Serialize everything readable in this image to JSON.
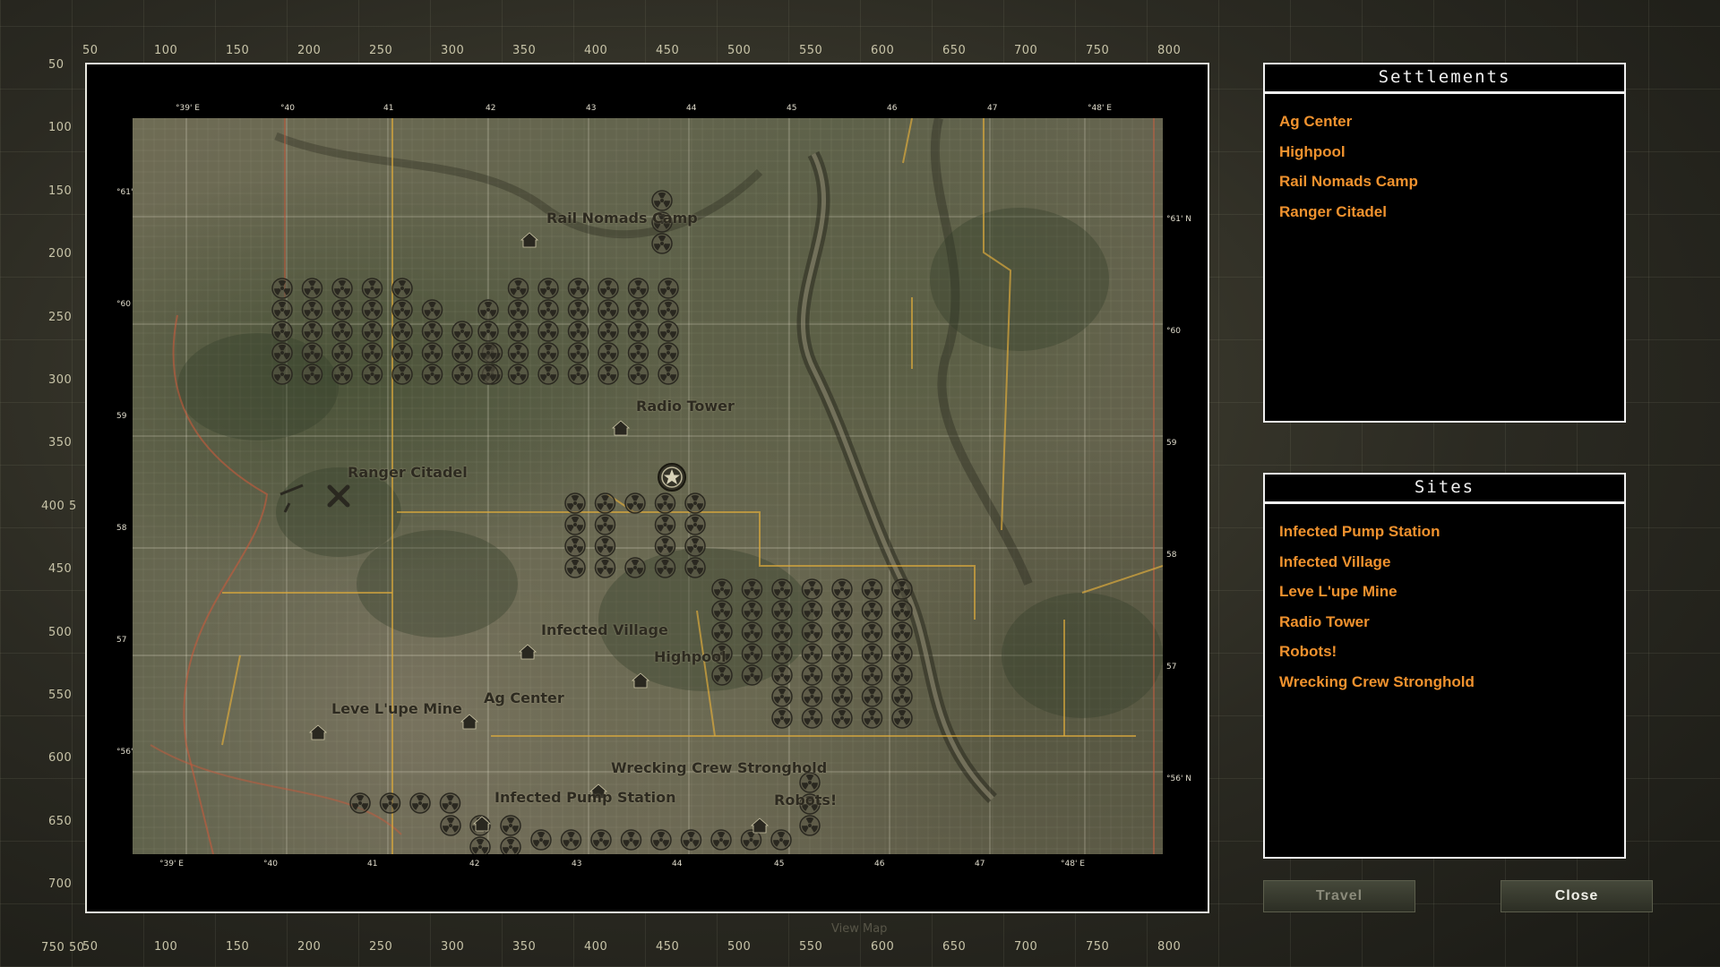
{
  "ruler": {
    "top": [
      "50",
      "100",
      "150",
      "200",
      "250",
      "300",
      "350",
      "400",
      "450",
      "500",
      "550",
      "600",
      "650",
      "700",
      "750",
      "800"
    ],
    "left": [
      "50",
      "100",
      "150",
      "200",
      "250",
      "300",
      "350",
      "400 5",
      "450",
      "500",
      "550",
      "600",
      "650",
      "700",
      "750 50"
    ]
  },
  "map": {
    "top_coords": [
      "°39' E",
      "°40",
      "41",
      "42",
      "43",
      "44",
      "45",
      "46",
      "47",
      "°48' E"
    ],
    "bottom_coords": [
      "°39' E",
      "°40",
      "41",
      "42",
      "43",
      "44",
      "45",
      "46",
      "47",
      "°48' E"
    ],
    "left_coords": [
      "°61' N",
      "°60",
      "59",
      "58",
      "57",
      "°56' N"
    ],
    "right_coords": [
      "°61' N",
      "°60",
      "59",
      "58",
      "57",
      "°56' N"
    ],
    "labels": {
      "rail_nomads": "Rail Nomads Camp",
      "radio_tower": "Radio Tower",
      "ranger_citadel": "Ranger Citadel",
      "infected_village": "Infected Village",
      "highpool": "Highpool",
      "ag_center": "Ag Center",
      "leve_lupe": "Leve L'upe Mine",
      "wrecking_crew": "Wrecking Crew Stronghold",
      "infected_pump": "Infected Pump Station",
      "robots": "Robots!"
    }
  },
  "settlements": {
    "title": "Settlements",
    "items": [
      "Ag Center",
      "Highpool",
      "Rail Nomads Camp",
      "Ranger Citadel"
    ]
  },
  "sites": {
    "title": "Sites",
    "items": [
      "Infected Pump Station",
      "Infected Village",
      "Leve L'upe Mine",
      "Radio Tower",
      "Robots!",
      "Wrecking Crew Stronghold"
    ]
  },
  "buttons": {
    "travel": "Travel",
    "close": "Close"
  },
  "footer": {
    "view_map": "View Map"
  },
  "colors": {
    "accent": "#f0922e",
    "frame": "#f0f0f0",
    "travel_text": "#8a8a7a",
    "close_text": "#f0f0e8"
  }
}
